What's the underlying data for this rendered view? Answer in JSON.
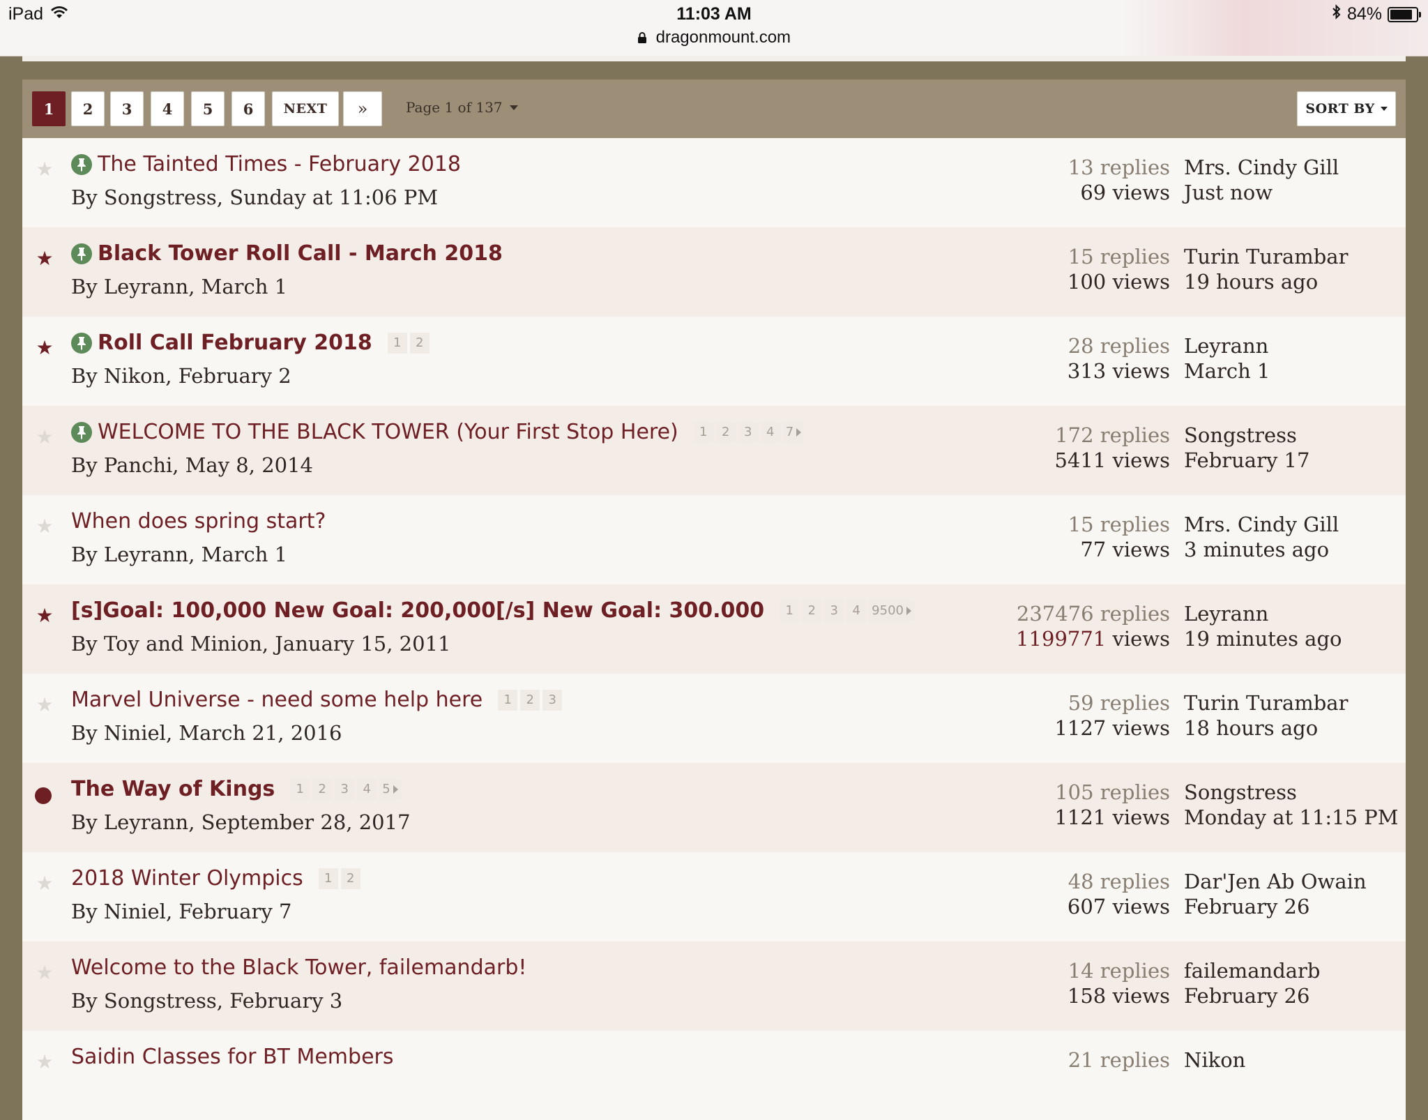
{
  "status_bar": {
    "device": "iPad",
    "time": "11:03 AM",
    "url": "dragonmount.com",
    "battery": "84%"
  },
  "pagination": {
    "pages": [
      "1",
      "2",
      "3",
      "4",
      "5",
      "6"
    ],
    "active_page": "1",
    "next_label": "NEXT",
    "last_label": "»",
    "page_info": "Page 1 of 137",
    "sort_label": "SORT BY"
  },
  "topics": [
    {
      "title": "The Tainted Times - February 2018",
      "bold": false,
      "pinned": true,
      "marker": "star-off",
      "byline": "By Songstress, Sunday at 11:06 PM",
      "pages": [],
      "replies": "13 replies",
      "views_num": "69",
      "views_label": " views",
      "views_hot": false,
      "last_user": "Mrs. Cindy Gill",
      "last_time": "Just now"
    },
    {
      "title": "Black Tower Roll Call - March 2018",
      "bold": true,
      "pinned": true,
      "marker": "star-on",
      "byline": "By Leyrann, March 1",
      "pages": [],
      "replies": "15 replies",
      "views_num": "100",
      "views_label": " views",
      "views_hot": false,
      "last_user": "Turin Turambar",
      "last_time": "19 hours ago"
    },
    {
      "title": "Roll Call February 2018",
      "bold": true,
      "pinned": true,
      "marker": "star-on",
      "byline": "By Nikon, February 2",
      "pages": [
        "1",
        "2"
      ],
      "more": false,
      "replies": "28 replies",
      "views_num": "313",
      "views_label": " views",
      "views_hot": false,
      "last_user": "Leyrann",
      "last_time": "March 1"
    },
    {
      "title": "WELCOME TO THE BLACK TOWER (Your First Stop Here)",
      "bold": false,
      "pinned": true,
      "marker": "star-off",
      "byline": "By Panchi, May 8, 2014",
      "pages": [
        "1",
        "2",
        "3",
        "4",
        "7"
      ],
      "more": true,
      "replies": "172 replies",
      "views_num": "5411",
      "views_label": " views",
      "views_hot": false,
      "last_user": "Songstress",
      "last_time": "February 17"
    },
    {
      "title": "When does spring start?",
      "bold": false,
      "pinned": false,
      "marker": "star-off",
      "byline": "By Leyrann, March 1",
      "pages": [],
      "replies": "15 replies",
      "views_num": "77",
      "views_label": " views",
      "views_hot": false,
      "last_user": "Mrs. Cindy Gill",
      "last_time": "3 minutes ago"
    },
    {
      "title": "[s]Goal: 100,000 New Goal: 200,000[/s] New Goal: 300.000",
      "bold": true,
      "pinned": false,
      "marker": "star-on",
      "byline": "By Toy and Minion, January 15, 2011",
      "pages": [
        "1",
        "2",
        "3",
        "4",
        "9500"
      ],
      "more": true,
      "replies": "237476 replies",
      "views_num": "1199771",
      "views_label": " views",
      "views_hot": true,
      "last_user": "Leyrann",
      "last_time": "19 minutes ago"
    },
    {
      "title": "Marvel Universe - need some help here",
      "bold": false,
      "pinned": false,
      "marker": "star-off",
      "byline": "By Niniel, March 21, 2016",
      "pages": [
        "1",
        "2",
        "3"
      ],
      "more": false,
      "replies": "59 replies",
      "views_num": "1127",
      "views_label": " views",
      "views_hot": false,
      "last_user": "Turin Turambar",
      "last_time": "18 hours ago"
    },
    {
      "title": "The Way of Kings",
      "bold": true,
      "pinned": false,
      "marker": "dot",
      "byline": "By Leyrann, September 28, 2017",
      "pages": [
        "1",
        "2",
        "3",
        "4",
        "5"
      ],
      "more": true,
      "replies": "105 replies",
      "views_num": "1121",
      "views_label": " views",
      "views_hot": false,
      "last_user": "Songstress",
      "last_time": "Monday at 11:15 PM"
    },
    {
      "title": "2018 Winter Olympics",
      "bold": false,
      "pinned": false,
      "marker": "star-off",
      "byline": "By Niniel, February 7",
      "pages": [
        "1",
        "2"
      ],
      "more": false,
      "replies": "48 replies",
      "views_num": "607",
      "views_label": " views",
      "views_hot": false,
      "last_user": "Dar'Jen Ab Owain",
      "last_time": "February 26"
    },
    {
      "title": "Welcome to the Black Tower, failemandarb!",
      "bold": false,
      "pinned": false,
      "marker": "star-off",
      "byline": "By Songstress, February 3",
      "pages": [],
      "replies": "14 replies",
      "views_num": "158",
      "views_label": " views",
      "views_hot": false,
      "last_user": "failemandarb",
      "last_time": "February 26"
    },
    {
      "title": "Saidin Classes for BT Members",
      "bold": false,
      "pinned": false,
      "marker": "star-off",
      "byline": "",
      "pages": [],
      "replies": "21 replies",
      "views_num": "",
      "views_label": "",
      "views_hot": false,
      "last_user": "Nikon",
      "last_time": ""
    }
  ]
}
